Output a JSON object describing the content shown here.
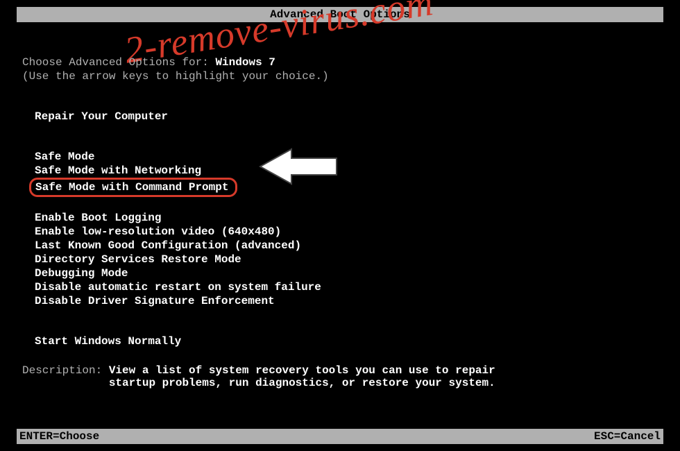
{
  "title": "Advanced Boot Options",
  "prompt_prefix": "Choose Advanced Options for: ",
  "os_name": "Windows 7",
  "hint": "(Use the arrow keys to highlight your choice.)",
  "repair_label": "Repair Your Computer",
  "menu_group1": [
    "Safe Mode",
    "Safe Mode with Networking",
    "Safe Mode with Command Prompt"
  ],
  "menu_group2": [
    "Enable Boot Logging",
    "Enable low-resolution video (640x480)",
    "Last Known Good Configuration (advanced)",
    "Directory Services Restore Mode",
    "Debugging Mode",
    "Disable automatic restart on system failure",
    "Disable Driver Signature Enforcement"
  ],
  "menu_group3": [
    "Start Windows Normally"
  ],
  "highlighted_index": 2,
  "description_label": "Description:   ",
  "description_text_line1": "View a list of system recovery tools you can use to repair",
  "description_text_line2": "startup problems, run diagnostics, or restore your system.",
  "footer_left": "ENTER=Choose",
  "footer_right": "ESC=Cancel",
  "watermark": "2-remove-virus.com",
  "colors": {
    "highlight": "#d63a2a",
    "text": "#b0b0b0",
    "bright": "#ffffff",
    "bar": "#b0b0b0"
  }
}
